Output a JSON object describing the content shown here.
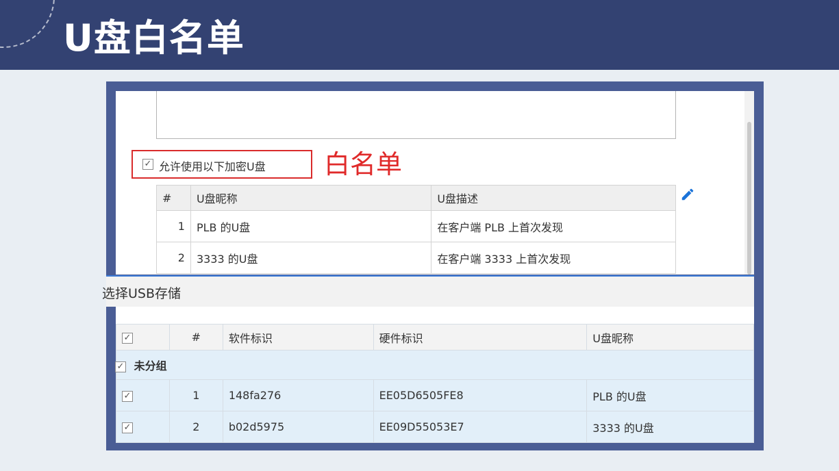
{
  "header": {
    "title": "U盘白名单"
  },
  "whitelist": {
    "allow_label": "允许使用以下加密U盘",
    "allow_checked": "✓",
    "annotation": "白名单",
    "columns": [
      "#",
      "U盘昵称",
      "U盘描述"
    ],
    "rows": [
      {
        "num": "1",
        "name": "PLB 的U盘",
        "desc": "在客户端 PLB 上首次发现"
      },
      {
        "num": "2",
        "name": "3333 的U盘",
        "desc": "在客户端 3333 上首次发现"
      }
    ]
  },
  "usb": {
    "title": "选择USB存储",
    "check_mark": "✓",
    "columns": [
      "#",
      "软件标识",
      "硬件标识",
      "U盘昵称"
    ],
    "group": "未分组",
    "rows": [
      {
        "num": "1",
        "soft_id": "148fa276",
        "hard_id": "EE05D6505FE8",
        "name": "PLB 的U盘"
      },
      {
        "num": "2",
        "soft_id": "b02d5975",
        "hard_id": "EE09D55053E7",
        "name": "3333 的U盘"
      }
    ]
  },
  "colors": {
    "header_bg": "#334272",
    "frame": "#4a5d95",
    "accent_red": "#e02a2a",
    "edit_icon": "#1a73d9",
    "row_highlight": "#e2eff9"
  },
  "icons": {
    "edit": "pencil-icon",
    "check": "checkbox-checked-icon"
  }
}
